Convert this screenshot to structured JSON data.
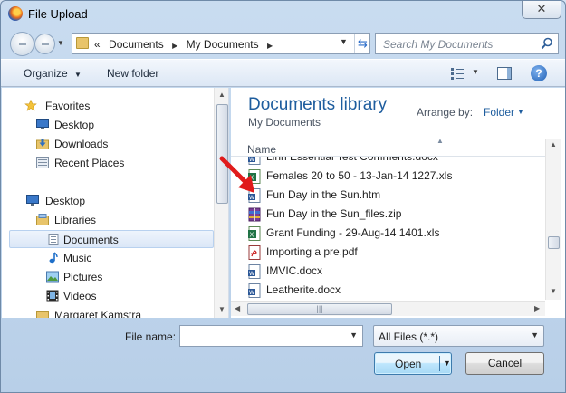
{
  "window": {
    "title": "File Upload",
    "close_glyph": "✕"
  },
  "address": {
    "prefix": "«",
    "crumbs": [
      "Documents",
      "My Documents"
    ],
    "search_placeholder": "Search My Documents"
  },
  "toolbar": {
    "organize": "Organize",
    "new_folder": "New folder",
    "help": "?"
  },
  "nav": {
    "items": [
      {
        "label": "Favorites",
        "icon": "star-icon"
      },
      {
        "label": "Desktop",
        "icon": "desktop-icon"
      },
      {
        "label": "Downloads",
        "icon": "downloads-icon"
      },
      {
        "label": "Recent Places",
        "icon": "recent-places-icon"
      },
      {
        "label": "Desktop",
        "icon": "desktop-icon"
      },
      {
        "label": "Libraries",
        "icon": "libraries-icon"
      },
      {
        "label": "Documents",
        "icon": "documents-icon",
        "selected": true
      },
      {
        "label": "Music",
        "icon": "music-icon"
      },
      {
        "label": "Pictures",
        "icon": "pictures-icon"
      },
      {
        "label": "Videos",
        "icon": "videos-icon"
      },
      {
        "label": "Margaret Kamstra",
        "icon": "user-folder-icon"
      }
    ]
  },
  "library": {
    "title": "Documents library",
    "subtitle": "My Documents",
    "arrange_label": "Arrange by:",
    "arrange_value": "Folder"
  },
  "columns": {
    "name": "Name"
  },
  "files": [
    {
      "name": "Linn Essential Test Comments.docx",
      "type": "word"
    },
    {
      "name": "Females 20 to 50 - 13-Jan-14 1227.xls",
      "type": "excel"
    },
    {
      "name": "Fun Day in the Sun.htm",
      "type": "word"
    },
    {
      "name": "Fun Day in the Sun_files.zip",
      "type": "zip"
    },
    {
      "name": "Grant Funding - 29-Aug-14 1401.xls",
      "type": "excel"
    },
    {
      "name": "Importing a pre.pdf",
      "type": "pdf"
    },
    {
      "name": "IMVIC.docx",
      "type": "word"
    },
    {
      "name": "Leatherite.docx",
      "type": "word"
    }
  ],
  "footer": {
    "file_name_label": "File name:",
    "file_name_value": "",
    "filter_value": "All Files (*.*)",
    "open": "Open",
    "cancel": "Cancel"
  },
  "colors": {
    "accent": "#1e5d9e",
    "arrow": "#e01b1b"
  }
}
